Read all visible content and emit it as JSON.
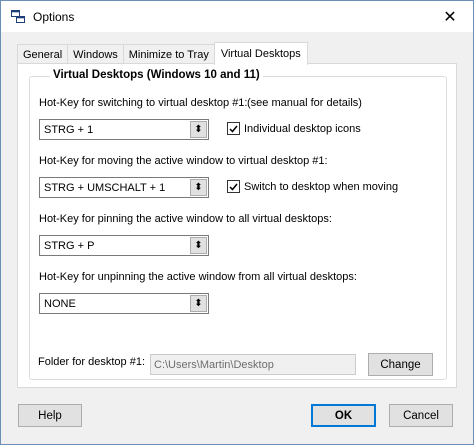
{
  "window": {
    "title": "Options"
  },
  "tabs": [
    {
      "label": "General"
    },
    {
      "label": "Windows"
    },
    {
      "label": "Minimize to Tray"
    },
    {
      "label": "Virtual Desktops",
      "active": true
    }
  ],
  "group": {
    "title": "Virtual Desktops (Windows 10 and 11)"
  },
  "hotkeys": {
    "switch": {
      "label": "Hot-Key for switching to virtual desktop #1:",
      "note": "(see manual for details)",
      "value": "STRG + 1"
    },
    "move": {
      "label": "Hot-Key for moving the active window to virtual desktop #1:",
      "value": "STRG + UMSCHALT + 1"
    },
    "pin": {
      "label": "Hot-Key for pinning the active window to all virtual desktops:",
      "value": "STRG + P"
    },
    "unpin": {
      "label": "Hot-Key for unpinning the active window from all virtual desktops:",
      "value": "NONE"
    }
  },
  "checkboxes": {
    "individual_icons": {
      "label": "Individual desktop icons",
      "checked": true
    },
    "switch_when_moving": {
      "label": "Switch to desktop when moving",
      "checked": true
    }
  },
  "folder": {
    "label": "Folder for desktop #1:",
    "value": "C:\\Users\\Martin\\Desktop",
    "change_label": "Change"
  },
  "buttons": {
    "help": "Help",
    "ok": "OK",
    "cancel": "Cancel"
  },
  "icons": {
    "app": "window-options-icon",
    "close": "close-icon",
    "combo": "dropdown-icon",
    "check": "checkmark-icon"
  }
}
